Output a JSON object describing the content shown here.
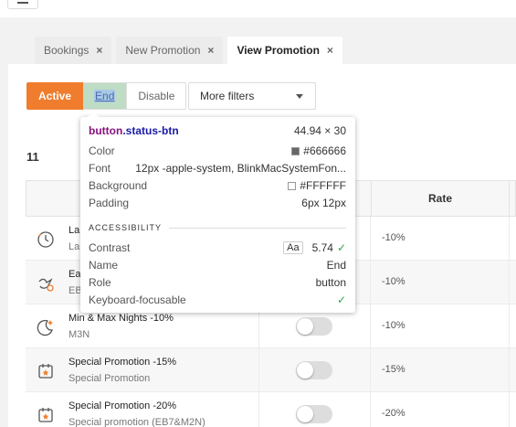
{
  "tabs": [
    {
      "label": "Bookings",
      "close": "×"
    },
    {
      "label": "New Promotion",
      "close": "×"
    },
    {
      "label": "View Promotion",
      "close": "×"
    }
  ],
  "filters": {
    "active": "Active",
    "end": "End",
    "disable": "Disable",
    "more": "More filters"
  },
  "count": "11",
  "table": {
    "rate_header": "Rate",
    "rows": [
      {
        "name": "La",
        "code": "La",
        "rate": "-10%",
        "icon": "clock-icon"
      },
      {
        "name": "Ea",
        "code": "EB",
        "rate": "-10%",
        "icon": "bird-icon"
      },
      {
        "name": "Min & Max Nights -10%",
        "code": "M3N",
        "rate": "-10%",
        "icon": "moon-icon"
      },
      {
        "name": "Special Promotion -15%",
        "code": "Special Promotion",
        "rate": "-15%",
        "icon": "calendar-star-icon"
      },
      {
        "name": "Special Promotion -20%",
        "code": "Special promotion (EB7&M2N)",
        "rate": "-20%",
        "icon": "calendar-star-icon"
      }
    ]
  },
  "tooltip": {
    "selector": "button",
    "class": ".status-btn",
    "size": "44.94 × 30",
    "color_label": "Color",
    "color_value": "#666666",
    "font_label": "Font",
    "font_value": "12px -apple-system, BlinkMacSystemFon...",
    "background_label": "Background",
    "background_value": "#FFFFFF",
    "padding_label": "Padding",
    "padding_value": "6px 12px",
    "accessibility_label": "ACCESSIBILITY",
    "contrast_label": "Contrast",
    "contrast_aa": "Aa",
    "contrast_value": "5.74",
    "name_label": "Name",
    "name_value": "End",
    "role_label": "Role",
    "role_value": "button",
    "focus_label": "Keyboard-focusable"
  },
  "colors": {
    "accent": "#ef7d2d",
    "text_swatch": "#666666",
    "bg_swatch": "#FFFFFF",
    "check": "#2ea44f"
  }
}
